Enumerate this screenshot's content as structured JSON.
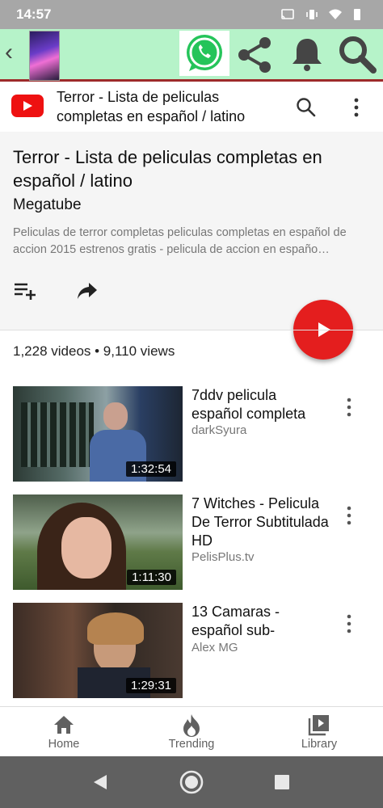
{
  "status_bar": {
    "time": "14:57"
  },
  "yt_header": {
    "title": "Terror - Lista de peliculas completas en español / latino"
  },
  "playlist": {
    "title": "Terror - Lista de peliculas completas en español / latino",
    "channel": "Megatube",
    "description": "Peliculas de terror completas peliculas completas en español de accion 2015 estrenos gratis - pelicula de accion en españo…",
    "stats": "1,228 videos • 9,110 views"
  },
  "videos": [
    {
      "title": "7ddv pelicula español completa",
      "channel": "darkSyura",
      "duration": "1:32:54"
    },
    {
      "title": "7 Witches - Pelicula De Terror Subtitulada HD",
      "channel": "PelisPlus.tv",
      "duration": "1:11:30"
    },
    {
      "title": "13 Camaras - español sub-",
      "channel": "Alex MG",
      "duration": "1:29:31"
    }
  ],
  "bottom_nav": {
    "home": "Home",
    "trending": "Trending",
    "library": "Library"
  },
  "colors": {
    "accent": "#e41e1e",
    "appbar": "#b6f3c9",
    "status": "#a7a7a7"
  }
}
